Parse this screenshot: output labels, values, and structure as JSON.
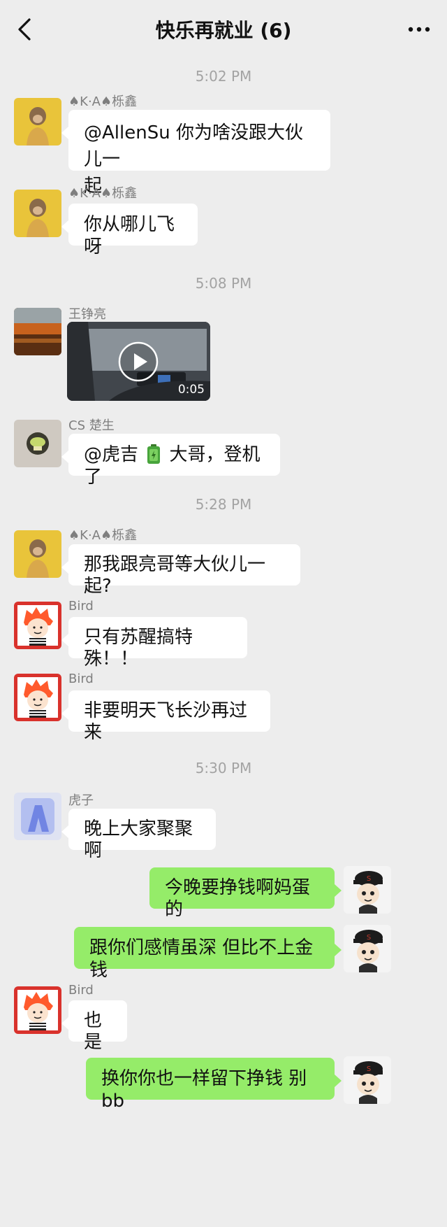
{
  "header": {
    "title": "快乐再就业 (6)",
    "back_icon": "chevron-left-icon",
    "more_icon": "more-icon"
  },
  "timestamps": [
    "5:02 PM",
    "5:08 PM",
    "5:28 PM",
    "5:30 PM"
  ],
  "messages": [
    {
      "sender": "♠K·A♠栎鑫",
      "text": "@AllenSu 你为啥没跟大伙儿一起",
      "line1": "@AllenSu 你为啥没跟大伙儿一",
      "line2": "起"
    },
    {
      "sender": "♠K·A♠栎鑫",
      "text": "你从哪儿飞呀"
    },
    {
      "sender": "王铮亮",
      "type": "video",
      "duration": "0:05"
    },
    {
      "sender": "CS 楚生",
      "text_before": "@虎吉",
      "emoji": "battery-icon",
      "text_after": "大哥，登机了"
    },
    {
      "sender": "♠K·A♠栎鑫",
      "text": "那我跟亮哥等大伙儿一起?"
    },
    {
      "sender": "Bird",
      "text": "只有苏醒搞特殊！！"
    },
    {
      "sender": "Bird",
      "text": "非要明天飞长沙再过来"
    },
    {
      "sender": "虎子",
      "text": "晚上大家聚聚啊"
    },
    {
      "sender": "me",
      "text": "今晚要挣钱啊妈蛋的"
    },
    {
      "sender": "me",
      "text": "跟你们感情虽深 但比不上金钱"
    },
    {
      "sender": "Bird",
      "text": "也是"
    },
    {
      "sender": "me",
      "text": "换你你也一样留下挣钱 别bb"
    }
  ],
  "colors": {
    "background": "#ededed",
    "bubble_in": "#ffffff",
    "bubble_out": "#95ec69"
  }
}
